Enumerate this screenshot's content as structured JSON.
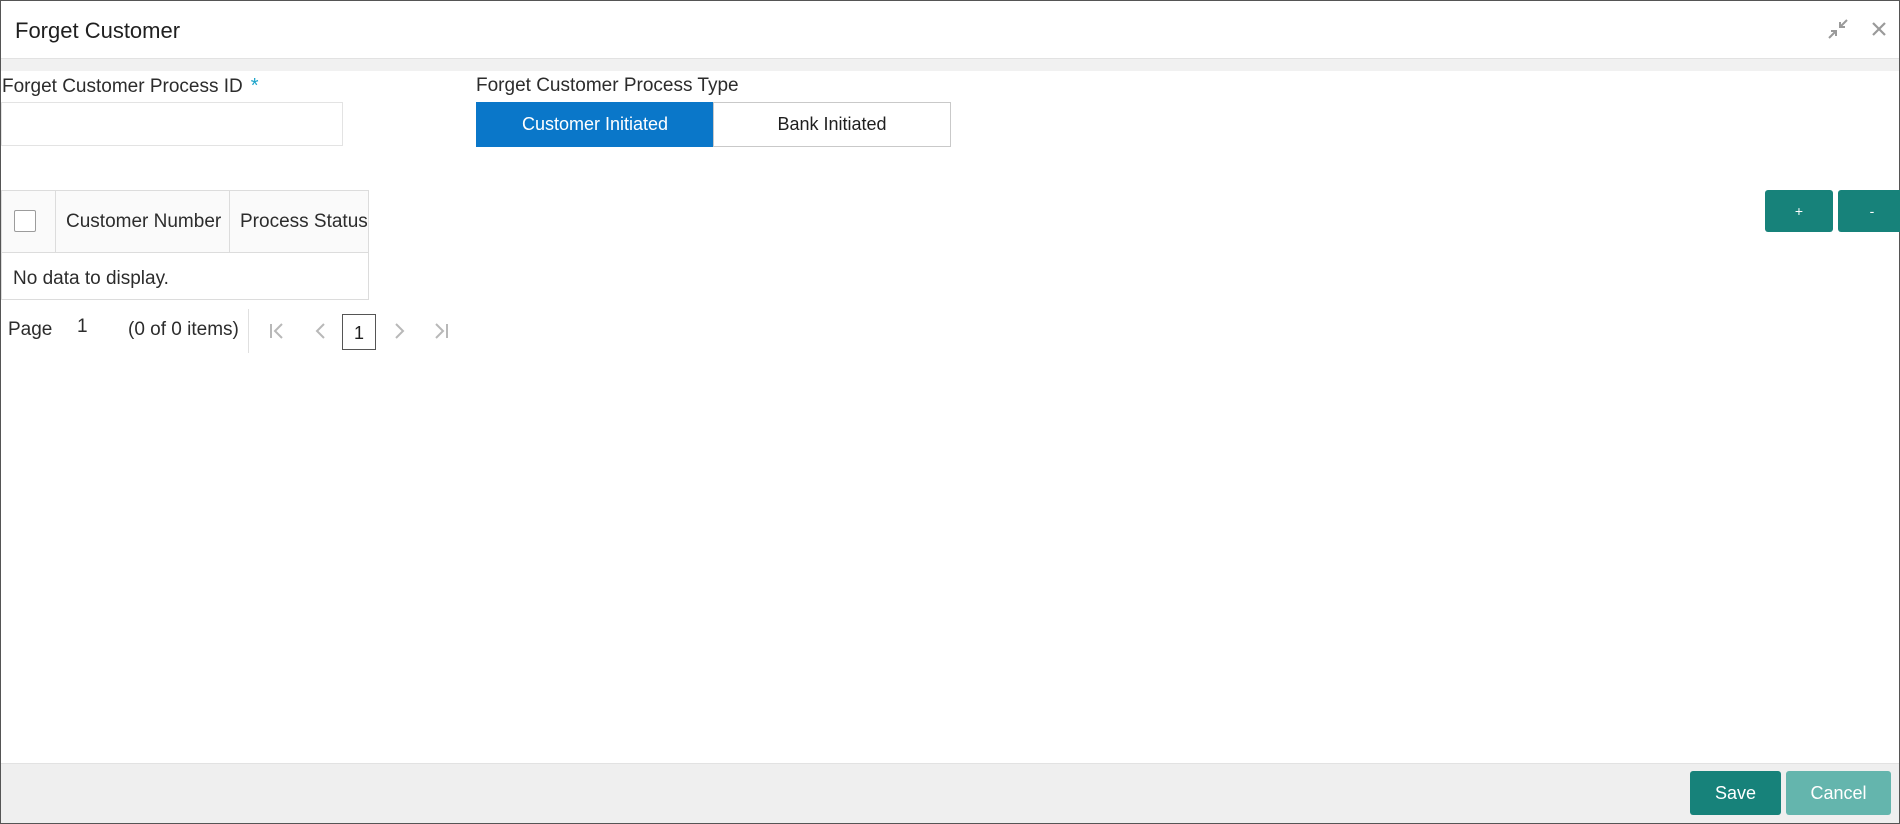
{
  "window": {
    "title": "Forget Customer",
    "icons": [
      "minimize-arrows-icon",
      "close-icon"
    ]
  },
  "form": {
    "process_id": {
      "label": "Forget Customer Process ID",
      "required_mark": "*",
      "value": "",
      "placeholder": ""
    },
    "process_type": {
      "label": "Forget Customer Process Type",
      "options": [
        "Customer Initiated",
        "Bank Initiated"
      ],
      "selected": "Customer Initiated"
    }
  },
  "grid": {
    "columns": [
      "Customer Number",
      "Process Status"
    ],
    "rows": [],
    "empty_text": "No data to display.",
    "add_label": "+",
    "remove_label": "-"
  },
  "pager": {
    "page_label": "Page",
    "page_value": "1",
    "items_text": "(0 of 0 items)",
    "current_page": "1"
  },
  "footer": {
    "save_label": "Save",
    "cancel_label": "Cancel"
  },
  "colors": {
    "accent": "#0a77c9",
    "teal": "#17827a",
    "teal_light": "#64b5ad",
    "required": "#1aa3c9"
  }
}
